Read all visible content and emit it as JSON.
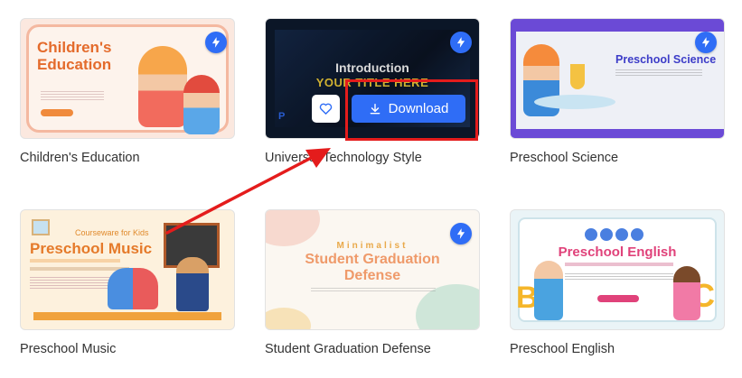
{
  "accent_color": "#2f6df6",
  "annotation_color": "#e41c1c",
  "cards": [
    {
      "title": "Children's Education",
      "thumb": {
        "heading_line1": "Children's",
        "heading_line2": "Education"
      }
    },
    {
      "title": "Universal Technology Style",
      "thumb": {
        "heading": "Introduction",
        "subheading": "YOUR TITLE HERE",
        "logo": "P"
      },
      "hover_actions": {
        "favorite_icon": "heart-icon",
        "download_icon": "download-icon",
        "download_label": "Download"
      }
    },
    {
      "title": "Preschool Science",
      "thumb": {
        "heading": "Preschool Science"
      }
    },
    {
      "title": "Preschool Music",
      "thumb": {
        "kicker": "Courseware for Kids",
        "heading": "Preschool Music"
      }
    },
    {
      "title": "Student Graduation Defense",
      "thumb": {
        "kicker": "Minimalist",
        "heading_line1": "Student Graduation",
        "heading_line2": "Defense"
      }
    },
    {
      "title": "Preschool English",
      "thumb": {
        "heading": "Preschool English",
        "letter_left": "B",
        "letter_right": "C"
      }
    }
  ],
  "badge_icon": "lightning-icon"
}
